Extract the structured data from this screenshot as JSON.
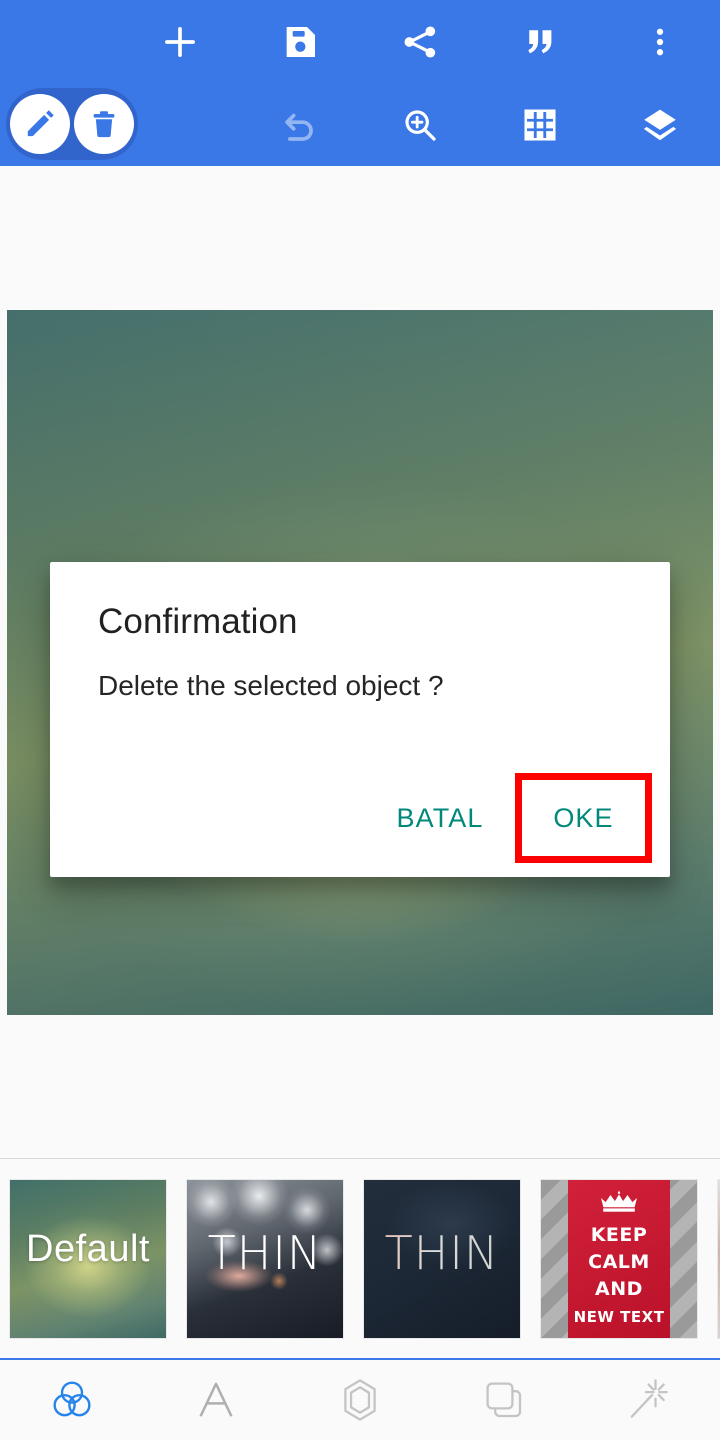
{
  "app": {
    "accent_blue": "#3B78E7",
    "pill_blue": "#3165CC",
    "teal_action": "#00897B",
    "highlight_red": "#FF0000"
  },
  "toolbar": {
    "row1": [
      {
        "name": "add-icon",
        "label": "Add"
      },
      {
        "name": "save-icon",
        "label": "Save"
      },
      {
        "name": "share-icon",
        "label": "Share"
      },
      {
        "name": "quote-icon",
        "label": "Quote"
      },
      {
        "name": "more-options-icon",
        "label": "More options"
      }
    ],
    "row2": [
      {
        "name": "edit-icon",
        "label": "Edit",
        "selected": true
      },
      {
        "name": "delete-icon",
        "label": "Delete",
        "selected": true
      },
      {
        "name": "undo-icon",
        "label": "Undo",
        "disabled": true
      },
      {
        "name": "zoom-in-icon",
        "label": "Zoom in"
      },
      {
        "name": "grid-icon",
        "label": "Grid"
      },
      {
        "name": "layers-icon",
        "label": "Layers"
      }
    ]
  },
  "dialog": {
    "title": "Confirmation",
    "message": "Delete the selected object ?",
    "cancel_label": "BATAL",
    "confirm_label": "OKE",
    "confirm_highlighted": true
  },
  "thumbnails": [
    {
      "id": "default",
      "label": "Default"
    },
    {
      "id": "thin-bokeh",
      "label": "THIN"
    },
    {
      "id": "thin-navy",
      "label": "THIN"
    },
    {
      "id": "keep-calm",
      "lines": [
        "KEEP",
        "CALM",
        "AND",
        "NEW TEXT"
      ]
    },
    {
      "id": "partial",
      "label": ""
    }
  ],
  "bottom_nav": [
    {
      "name": "filters-icon",
      "label": "Filters",
      "active": true
    },
    {
      "name": "text-icon",
      "label": "Text",
      "active": false
    },
    {
      "name": "shape-icon",
      "label": "Shape",
      "active": false
    },
    {
      "name": "duplicate-icon",
      "label": "Duplicate",
      "active": false
    },
    {
      "name": "magic-wand-icon",
      "label": "Effects",
      "active": false
    }
  ]
}
